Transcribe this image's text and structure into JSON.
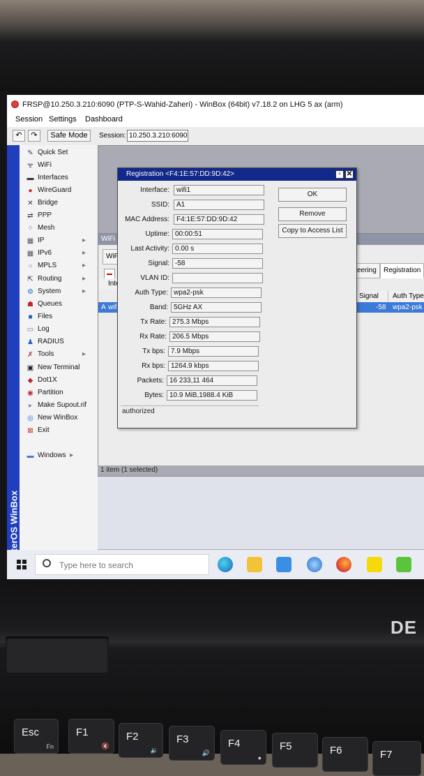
{
  "window": {
    "title": "FRSP@10.250.3.210:6090 (PTP-S-Wahid-Zaheri) - WinBox (64bit) v7.18.2 on LHG 5 ax (arm)"
  },
  "menu": [
    "Session",
    "Settings",
    "Dashboard"
  ],
  "toolbar": {
    "safe_mode": "Safe Mode",
    "session_label": "Session:",
    "session_value": "10.250.3.210:6090"
  },
  "brand_strip": "RouterOS WinBox",
  "sidebar": {
    "items": [
      {
        "label": "Quick Set",
        "icon": "wand-icon",
        "arrow": ""
      },
      {
        "label": "WiFi",
        "icon": "wifi-icon",
        "arrow": ""
      },
      {
        "label": "Interfaces",
        "icon": "interfaces-icon",
        "arrow": ""
      },
      {
        "label": "WireGuard",
        "icon": "wireguard-icon",
        "arrow": ""
      },
      {
        "label": "Bridge",
        "icon": "bridge-icon",
        "arrow": ""
      },
      {
        "label": "PPP",
        "icon": "ppp-icon",
        "arrow": ""
      },
      {
        "label": "Mesh",
        "icon": "mesh-icon",
        "arrow": ""
      },
      {
        "label": "IP",
        "icon": "ip-icon",
        "arrow": "▸"
      },
      {
        "label": "IPv6",
        "icon": "ipv6-icon",
        "arrow": "▸"
      },
      {
        "label": "MPLS",
        "icon": "mpls-icon",
        "arrow": "▸"
      },
      {
        "label": "Routing",
        "icon": "routing-icon",
        "arrow": "▸"
      },
      {
        "label": "System",
        "icon": "system-icon",
        "arrow": "▸"
      },
      {
        "label": "Queues",
        "icon": "queues-icon",
        "arrow": ""
      },
      {
        "label": "Files",
        "icon": "files-icon",
        "arrow": ""
      },
      {
        "label": "Log",
        "icon": "log-icon",
        "arrow": ""
      },
      {
        "label": "RADIUS",
        "icon": "radius-icon",
        "arrow": ""
      },
      {
        "label": "Tools",
        "icon": "tools-icon",
        "arrow": "▸"
      },
      {
        "label": "New Terminal",
        "icon": "terminal-icon",
        "arrow": ""
      },
      {
        "label": "Dot1X",
        "icon": "dot1x-icon",
        "arrow": ""
      },
      {
        "label": "Partition",
        "icon": "partition-icon",
        "arrow": ""
      },
      {
        "label": "Make Supout.rif",
        "icon": "supout-icon",
        "arrow": ""
      },
      {
        "label": "New WinBox",
        "icon": "winbox-icon",
        "arrow": ""
      },
      {
        "label": "Exit",
        "icon": "exit-icon",
        "arrow": ""
      }
    ],
    "windows": "Windows"
  },
  "wifi_window": {
    "title": "WiFi",
    "tab_wifi": "WiFi",
    "tab_steering": "eering",
    "tab_registration": "Registration",
    "col_interface": "Inter",
    "col_signal": "Signal",
    "col_auth": "Auth Type",
    "row_flag": "A",
    "row_interface": "wifi1",
    "row_signal": "-58",
    "row_auth": "wpa2-psk",
    "status": "1 item (1 selected)"
  },
  "registration": {
    "title": "Registration <F4:1E:57:DD:9D:42>",
    "fields": [
      {
        "label": "Interface:",
        "value": "wifi1"
      },
      {
        "label": "SSID:",
        "value": "A1"
      },
      {
        "label": "MAC Address:",
        "value": "F4:1E:57:DD:9D:42"
      },
      {
        "label": "Uptime:",
        "value": "00:00:51"
      },
      {
        "label": "Last Activity:",
        "value": "0.00 s"
      },
      {
        "label": "Signal:",
        "value": "-58"
      },
      {
        "label": "VLAN ID:",
        "value": ""
      },
      {
        "label": "Auth Type:",
        "value": "wpa2-psk"
      },
      {
        "label": "Band:",
        "value": "5GHz AX"
      },
      {
        "label": "Tx Rate:",
        "value": "275.3 Mbps"
      },
      {
        "label": "Rx Rate:",
        "value": "206.5 Mbps"
      },
      {
        "label": "Tx bps:",
        "value": "7.9 Mbps"
      },
      {
        "label": "Rx bps:",
        "value": "1264.9 kbps"
      },
      {
        "label": "Packets:",
        "value": "16 233,11 464"
      },
      {
        "label": "Bytes:",
        "value": "10.9 MiB,1988.4 KiB"
      }
    ],
    "buttons": {
      "ok": "OK",
      "remove": "Remove",
      "copy": "Copy to Access List"
    },
    "status": "authorized"
  },
  "taskbar": {
    "search_placeholder": "Type here to search"
  },
  "keyboard": {
    "keys": [
      {
        "label": "Esc",
        "sub": "Fn"
      },
      {
        "label": "F1",
        "sub": "🔇"
      },
      {
        "label": "F2",
        "sub": "🔉"
      },
      {
        "label": "F3",
        "sub": "🔊"
      },
      {
        "label": "F4",
        "sub": "●"
      },
      {
        "label": "F5",
        "sub": ""
      },
      {
        "label": "F6",
        "sub": ""
      },
      {
        "label": "F7",
        "sub": ""
      }
    ]
  },
  "laptop_brand": "DE"
}
